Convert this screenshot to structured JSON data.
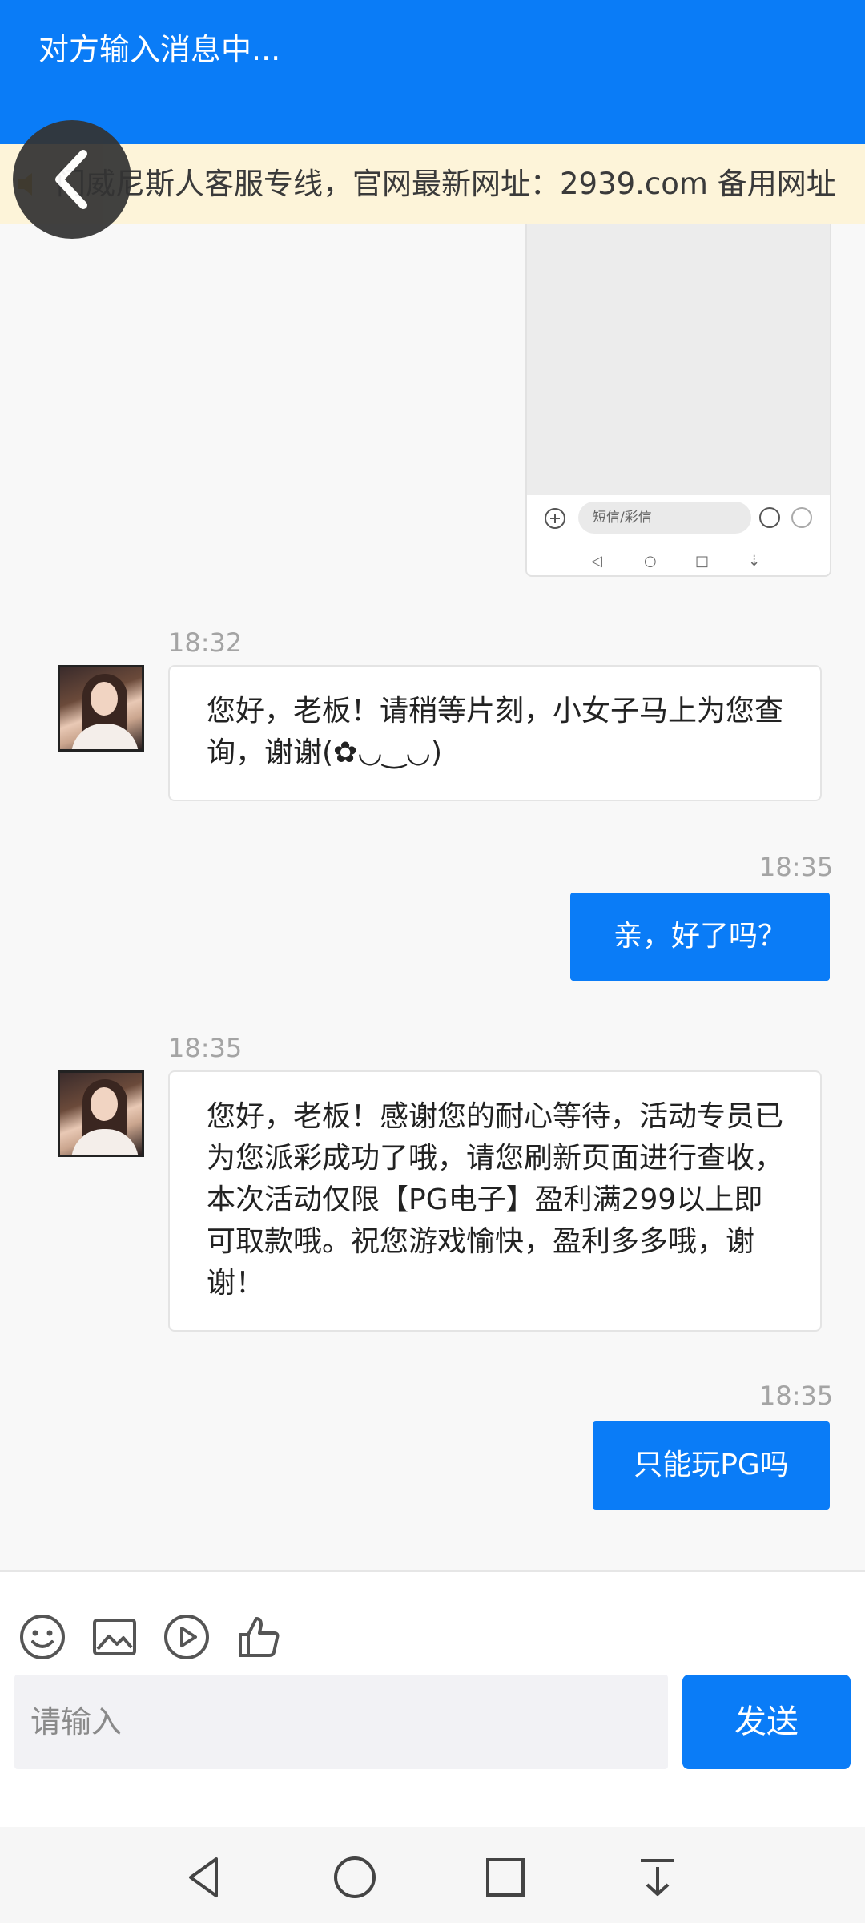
{
  "header": {
    "title": "对方输入消息中..."
  },
  "notice": {
    "text": "门威尼斯人客服专线，官网最新网址：2939.com 备用网址"
  },
  "preview": {
    "sms_placeholder": "短信/彩信"
  },
  "messages": [
    {
      "time": "18:32",
      "side": "in",
      "text": "您好，老板！请稍等片刻，小女子马上为您查询，谢谢(✿◡‿◡)"
    },
    {
      "time": "18:35",
      "side": "out",
      "text": "亲，好了吗？"
    },
    {
      "time": "18:35",
      "side": "in",
      "text": "您好，老板！感谢您的耐心等待，活动专员已为您派彩成功了哦，请您刷新页面进行查收，本次活动仅限【PG电子】盈利满299以上即可取款哦。祝您游戏愉快，盈利多多哦，谢谢！"
    },
    {
      "time": "18:35",
      "side": "out",
      "text": "只能玩PG吗"
    }
  ],
  "composer": {
    "placeholder": "请输入",
    "send_label": "发送"
  },
  "toolbar": {
    "icons": [
      "emoji-icon",
      "image-icon",
      "video-icon",
      "thumbs-up-icon"
    ]
  },
  "colors": {
    "primary": "#0a7cf7",
    "notice_bg": "#fdf4d9"
  }
}
